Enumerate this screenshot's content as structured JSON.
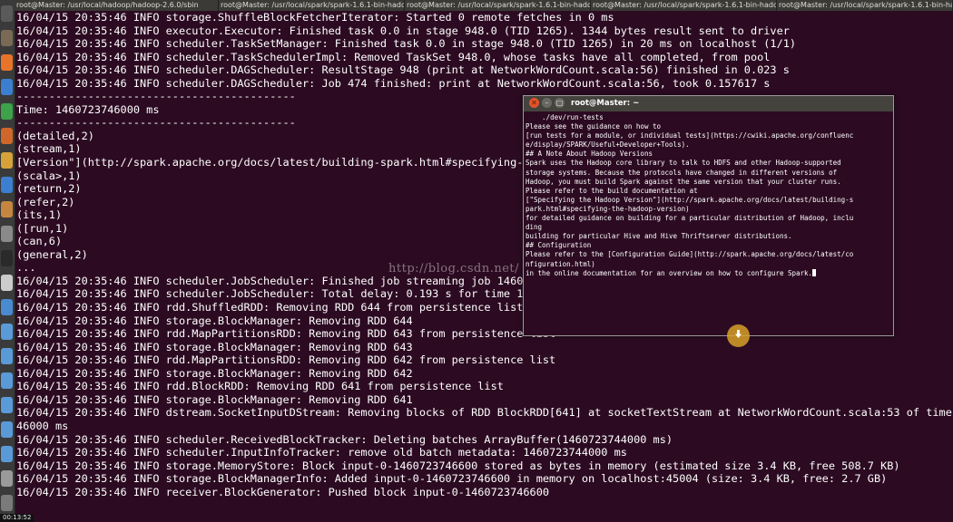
{
  "tabs": [
    "root@Master: /usr/local/hadoop/hadoop-2.6.0/sbin",
    "root@Master: /usr/local/spark/spark-1.6.1-bin-hadoop2.6/bin",
    "root@Master: /usr/local/spark/spark-1.6.1-bin-hadoop2.6/bin",
    "root@Master: /usr/local/spark/spark-1.6.1-bin-hadoop2.6/bin",
    "root@Master: /usr/local/spark/spark-1.6.1-bin-hadoop2.6/bin"
  ],
  "terminal": {
    "lines": [
      "16/04/15 20:35:46 INFO storage.ShuffleBlockFetcherIterator: Started 0 remote fetches in 0 ms",
      "16/04/15 20:35:46 INFO executor.Executor: Finished task 0.0 in stage 948.0 (TID 1265). 1344 bytes result sent to driver",
      "16/04/15 20:35:46 INFO scheduler.TaskSetManager: Finished task 0.0 in stage 948.0 (TID 1265) in 20 ms on localhost (1/1)",
      "16/04/15 20:35:46 INFO scheduler.TaskSchedulerImpl: Removed TaskSet 948.0, whose tasks have all completed, from pool",
      "16/04/15 20:35:46 INFO scheduler.DAGScheduler: ResultStage 948 (print at NetworkWordCount.scala:56) finished in 0.023 s",
      "16/04/15 20:35:46 INFO scheduler.DAGScheduler: Job 474 finished: print at NetworkWordCount.scala:56, took 0.157617 s",
      "-------------------------------------------",
      "Time: 1460723746000 ms",
      "-------------------------------------------",
      "(detailed,2)",
      "(stream,1)",
      "[Version\"](http://spark.apache.org/docs/latest/building-spark.html#specifying-the-h",
      "(scala>,1)",
      "(return,2)",
      "(refer,2)",
      "(its,1)",
      "([run,1)",
      "(can,6)",
      "(general,2)",
      "...",
      "",
      "16/04/15 20:35:46 INFO scheduler.JobScheduler: Finished job streaming job 14607237",
      "16/04/15 20:35:46 INFO scheduler.JobScheduler: Total delay: 0.193 s for time 146072",
      "16/04/15 20:35:46 INFO rdd.ShuffledRDD: Removing RDD 644 from persistence list",
      "16/04/15 20:35:46 INFO storage.BlockManager: Removing RDD 644",
      "16/04/15 20:35:46 INFO rdd.MapPartitionsRDD: Removing RDD 643 from persistence list",
      "16/04/15 20:35:46 INFO storage.BlockManager: Removing RDD 643",
      "16/04/15 20:35:46 INFO rdd.MapPartitionsRDD: Removing RDD 642 from persistence list",
      "16/04/15 20:35:46 INFO storage.BlockManager: Removing RDD 642",
      "16/04/15 20:35:46 INFO rdd.BlockRDD: Removing RDD 641 from persistence list",
      "16/04/15 20:35:46 INFO storage.BlockManager: Removing RDD 641",
      "16/04/15 20:35:46 INFO dstream.SocketInputDStream: Removing blocks of RDD BlockRDD[641] at socketTextStream at NetworkWordCount.scala:53 of time 14607237",
      "46000 ms",
      "16/04/15 20:35:46 INFO scheduler.ReceivedBlockTracker: Deleting batches ArrayBuffer(1460723744000 ms)",
      "16/04/15 20:35:46 INFO scheduler.InputInfoTracker: remove old batch metadata: 1460723744000 ms",
      "16/04/15 20:35:46 INFO storage.MemoryStore: Block input-0-1460723746600 stored as bytes in memory (estimated size 3.4 KB, free 508.7 KB)",
      "16/04/15 20:35:46 INFO storage.BlockManagerInfo: Added input-0-1460723746600 in memory on localhost:45004 (size: 3.4 KB, free: 2.7 GB)",
      "16/04/15 20:35:46 INFO receiver.BlockGenerator: Pushed block input-0-1460723746600"
    ]
  },
  "popup": {
    "title": "root@Master: ~",
    "lines": [
      "    ./dev/run-tests",
      "",
      "Please see the guidance on how to",
      "[run tests for a module, or individual tests](https://cwiki.apache.org/confluenc",
      "e/display/SPARK/Useful+Developer+Tools).",
      "",
      "## A Note About Hadoop Versions",
      "",
      "Spark uses the Hadoop core library to talk to HDFS and other Hadoop-supported",
      "storage systems. Because the protocols have changed in different versions of",
      "Hadoop, you must build Spark against the same version that your cluster runs.",
      "",
      "Please refer to the build documentation at",
      "[\"Specifying the Hadoop Version\"](http://spark.apache.org/docs/latest/building-s",
      "park.html#specifying-the-hadoop-version)",
      "for detailed guidance on building for a particular distribution of Hadoop, inclu",
      "ding",
      "building for particular Hive and Hive Thriftserver distributions.",
      "",
      "## Configuration",
      "",
      "Please refer to the [Configuration Guide](http://spark.apache.org/docs/latest/co",
      "nfiguration.html)",
      "in the online documentation for an overview on how to configure Spark."
    ]
  },
  "watermark": "http://blog.csdn.net/",
  "timer": "00:13:52",
  "launcher_icons": [
    {
      "name": "dash-home-icon",
      "color": "#5a5a5a"
    },
    {
      "name": "files-icon",
      "color": "#7a6a55"
    },
    {
      "name": "firefox-icon",
      "color": "#e8742a"
    },
    {
      "name": "writer-icon",
      "color": "#3c7fd0"
    },
    {
      "name": "calc-icon",
      "color": "#3da24a"
    },
    {
      "name": "impress-icon",
      "color": "#d0672a"
    },
    {
      "name": "software-center-icon",
      "color": "#d8a23a"
    },
    {
      "name": "help-icon",
      "color": "#3c7fd0"
    },
    {
      "name": "amazon-icon",
      "color": "#c68640"
    },
    {
      "name": "settings-icon",
      "color": "#8a8a8a"
    },
    {
      "name": "terminal-icon",
      "color": "#2a2a2a"
    },
    {
      "name": "text-editor-icon",
      "color": "#cccccc"
    },
    {
      "name": "image-viewer-icon",
      "color": "#4a8ad0"
    },
    {
      "name": "app-icon",
      "color": "#5a9ad8"
    },
    {
      "name": "app-icon",
      "color": "#5a9ad8"
    },
    {
      "name": "app-icon",
      "color": "#5a9ad8"
    },
    {
      "name": "app-icon",
      "color": "#5a9ad8"
    },
    {
      "name": "app-icon",
      "color": "#5a9ad8"
    },
    {
      "name": "app-icon",
      "color": "#5a9ad8"
    },
    {
      "name": "workspace-switcher-icon",
      "color": "#9a9a9a"
    },
    {
      "name": "trash-icon",
      "color": "#7a7a7a"
    }
  ],
  "colors": {
    "terminal_bg": "#2c0b22",
    "close_button": "#e2542a"
  }
}
